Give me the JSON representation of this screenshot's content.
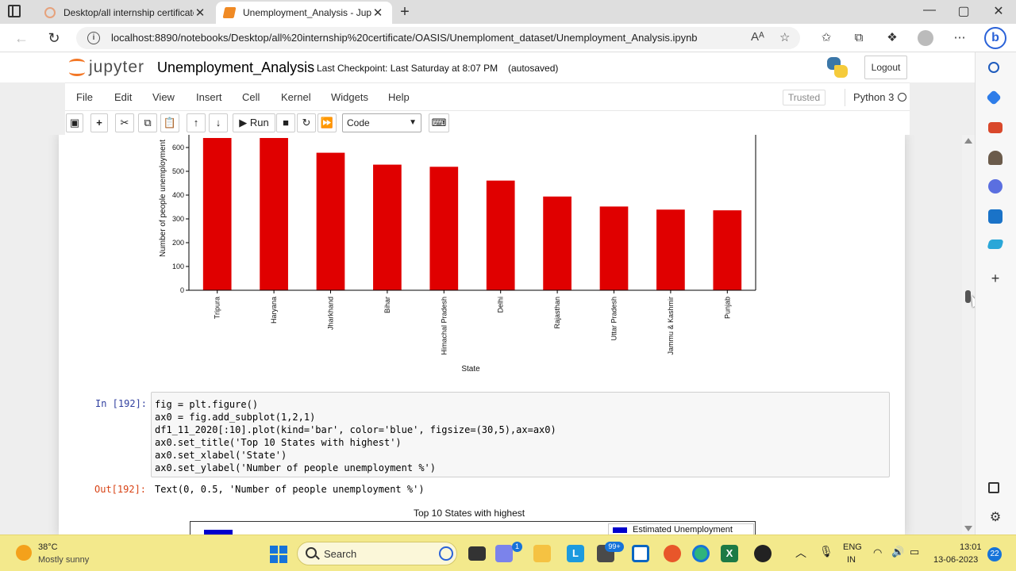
{
  "browser": {
    "tabs": [
      {
        "label": "Desktop/all internship certificate",
        "active": false
      },
      {
        "label": "Unemployment_Analysis - Jupyter",
        "active": true
      }
    ],
    "url": "localhost:8890/notebooks/Desktop/all%20internship%20certificate/OASIS/Unemploment_dataset/Unemployment_Analysis.ipynb",
    "window_controls": {
      "minimize": "—",
      "maximize": "▢",
      "close": "✕"
    },
    "new_tab": "+",
    "read_aloud": "Aᴬ"
  },
  "jupyter": {
    "logo_text": "jupyter",
    "notebook_name": "Unemployment_Analysis",
    "checkpoint": "Last Checkpoint: Last Saturday at 8:07 PM",
    "autosave": "(autosaved)",
    "logout": "Logout",
    "menu": [
      "File",
      "Edit",
      "View",
      "Insert",
      "Cell",
      "Kernel",
      "Widgets",
      "Help"
    ],
    "trusted": "Trusted",
    "kernel": "Python 3",
    "toolbar": {
      "run": "Run",
      "cell_type": "Code"
    }
  },
  "notebook": {
    "cell_in_prompt": "In [192]:",
    "cell_out_prompt": "Out[192]:",
    "output_text": "Text(0, 0.5, 'Number of people unemployment %')",
    "code_lines": [
      "fig = plt.figure()",
      "ax0 = fig.add_subplot(1,2,1)",
      "df1_11_2020[:10].plot(kind='bar', color='blue', figsize=(30,5),ax=ax0)",
      "ax0.set_title('Top 10 States with highest')",
      "ax0.set_xlabel('State')",
      "ax0.set_ylabel('Number of people unemployment %')"
    ],
    "chart2_title": "Top 10 States with highest",
    "chart2_legend": "Estimated Unemployment Rate"
  },
  "chart_data": [
    {
      "type": "bar",
      "title": "",
      "xlabel": "State",
      "ylabel": "Number of people unemployment",
      "categories": [
        "Tripura",
        "Haryana",
        "Jharkhand",
        "Bihar",
        "Himachal Pradesh",
        "Delhi",
        "Rajasthan",
        "Uttar Pradesh",
        "Jammu & Kashmir",
        "Punjab"
      ],
      "values": [
        640,
        640,
        578,
        528,
        519,
        461,
        394,
        352,
        339,
        336
      ],
      "yticks": [
        0,
        100,
        200,
        300,
        400,
        500,
        600
      ],
      "color": "#e00000",
      "clipped_top": true
    }
  ],
  "taskbar": {
    "temperature": "38°C",
    "condition": "Mostly sunny",
    "search": "Search",
    "lang": "ENG",
    "region": "IN",
    "time": "13:01",
    "date": "13-06-2023",
    "notifications": "22",
    "badge_teams": "1",
    "badge_mail": "99+"
  }
}
